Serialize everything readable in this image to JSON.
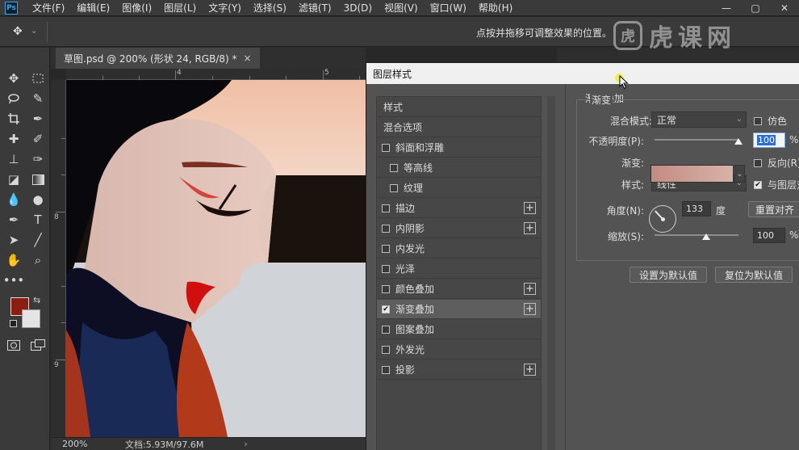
{
  "menubar": {
    "logo": "Ps",
    "items": [
      "文件(F)",
      "编辑(E)",
      "图像(I)",
      "图层(L)",
      "文字(Y)",
      "选择(S)",
      "滤镜(T)",
      "3D(D)",
      "视图(V)",
      "窗口(W)",
      "帮助(H)"
    ],
    "window_controls": [
      "—",
      "▢",
      "✕"
    ]
  },
  "options_bar": {
    "hint": "点按并拖移可调整效果的位置。"
  },
  "watermark": {
    "badge": "虎",
    "text": "虎课网"
  },
  "toolbar": {
    "foreground_color": "#8a1e12",
    "background_color": "#e4e4e4",
    "more": "•••"
  },
  "document": {
    "tab_title": "草图.psd @ 200% (形状 24, RGB/8) *",
    "close": "×",
    "ruler_top": [
      "4",
      "5"
    ],
    "ruler_left": [
      "8",
      "9"
    ],
    "zoom": "200%",
    "doc_size": "文档:5.93M/97.6M",
    "status_arrow": "›"
  },
  "dialog": {
    "title": "图层样式",
    "styles": [
      {
        "label": "样式",
        "type": "header"
      },
      {
        "label": "混合选项",
        "type": "header"
      },
      {
        "label": "斜面和浮雕",
        "checked": false,
        "plus": false,
        "indent": 0
      },
      {
        "label": "等高线",
        "checked": false,
        "plus": false,
        "indent": 1
      },
      {
        "label": "纹理",
        "checked": false,
        "plus": false,
        "indent": 1
      },
      {
        "label": "描边",
        "checked": false,
        "plus": true,
        "indent": 0
      },
      {
        "label": "内阴影",
        "checked": false,
        "plus": true,
        "indent": 0
      },
      {
        "label": "内发光",
        "checked": false,
        "plus": false,
        "indent": 0
      },
      {
        "label": "光泽",
        "checked": false,
        "plus": false,
        "indent": 0
      },
      {
        "label": "颜色叠加",
        "checked": false,
        "plus": true,
        "indent": 0
      },
      {
        "label": "渐变叠加",
        "checked": true,
        "plus": true,
        "indent": 0,
        "selected": true
      },
      {
        "label": "图案叠加",
        "checked": false,
        "plus": false,
        "indent": 0
      },
      {
        "label": "外发光",
        "checked": false,
        "plus": false,
        "indent": 0
      },
      {
        "label": "投影",
        "checked": false,
        "plus": true,
        "indent": 0
      }
    ],
    "gradient_overlay": {
      "section_title": "渐变叠加",
      "group_title": "渐变",
      "blend_mode_label": "混合模式:",
      "blend_mode_value": "正常",
      "dither_label": "仿色",
      "dither_checked": false,
      "opacity_label": "不透明度(P):",
      "opacity_value": "100",
      "opacity_unit": "%",
      "opacity_fraction": 1.0,
      "gradient_label": "渐变:",
      "gradient_colors": [
        "#c38b82",
        "#d7b3a8"
      ],
      "reverse_label": "反向(R)",
      "reverse_checked": false,
      "style_label": "样式:",
      "style_value": "线性",
      "align_label": "与图层对",
      "align_checked": true,
      "angle_label": "角度(N):",
      "angle_value": "133",
      "angle_unit": "度",
      "reset_align_button": "重置对齐",
      "scale_label": "缩放(S):",
      "scale_value": "100",
      "scale_unit": "%",
      "scale_fraction": 0.62,
      "make_default_button": "设置为默认值",
      "reset_default_button": "复位为默认值"
    }
  }
}
